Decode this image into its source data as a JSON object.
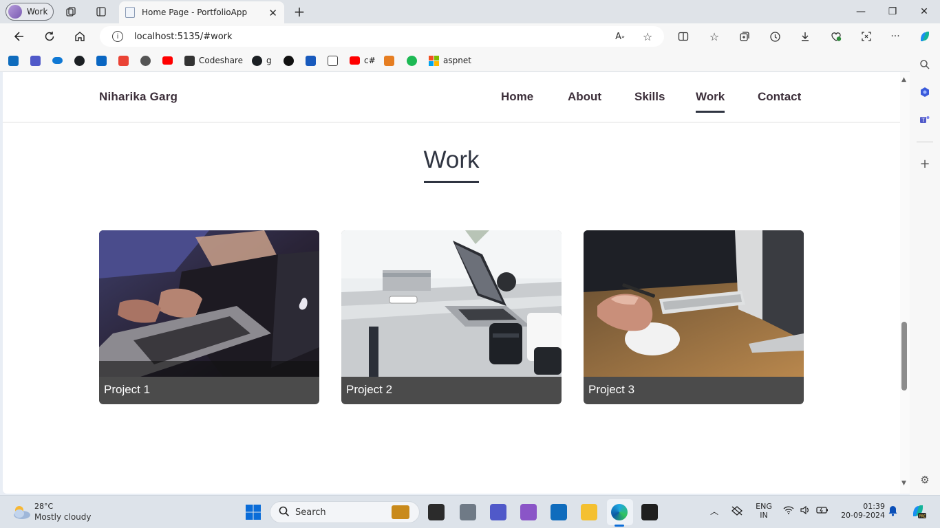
{
  "browser": {
    "profile_label": "Work",
    "tab_title": "Home Page - PortfolioApp",
    "url": "localhost:5135/#work",
    "favorites": [
      {
        "label": "",
        "color": "#0f6cbd"
      },
      {
        "label": "",
        "color": "#5059c9"
      },
      {
        "label": "",
        "color": "#0f78d4"
      },
      {
        "label": "",
        "color": "#1b1f23"
      },
      {
        "label": "",
        "color": "#0a66c2"
      },
      {
        "label": "",
        "color": "#ea4335"
      },
      {
        "label": "",
        "color": "#555555"
      },
      {
        "label": "",
        "color": "#ff0000"
      },
      {
        "label": "Codeshare",
        "color": "#333333"
      },
      {
        "label": "g",
        "color": "#1b1f23"
      },
      {
        "label": "",
        "color": "#111111"
      },
      {
        "label": "",
        "color": "#185abd"
      },
      {
        "label": "",
        "color": "#444444"
      },
      {
        "label": "c#",
        "color": "#ff0000"
      },
      {
        "label": "",
        "color": "#e67e22"
      },
      {
        "label": "",
        "color": "#1db954"
      },
      {
        "label": "aspnet",
        "color": "#f25022"
      }
    ]
  },
  "site": {
    "brand": "Niharika Garg",
    "nav": [
      "Home",
      "About",
      "Skills",
      "Work",
      "Contact"
    ],
    "active_nav": "Work",
    "section_title": "Work",
    "projects": [
      {
        "title": "Project 1"
      },
      {
        "title": "Project 2"
      },
      {
        "title": "Project 3"
      }
    ]
  },
  "taskbar": {
    "weather_temp": "28°C",
    "weather_desc": "Mostly cloudy",
    "search_placeholder": "Search",
    "lang_1": "ENG",
    "lang_2": "IN",
    "time": "01:39",
    "date": "20-09-2024"
  }
}
